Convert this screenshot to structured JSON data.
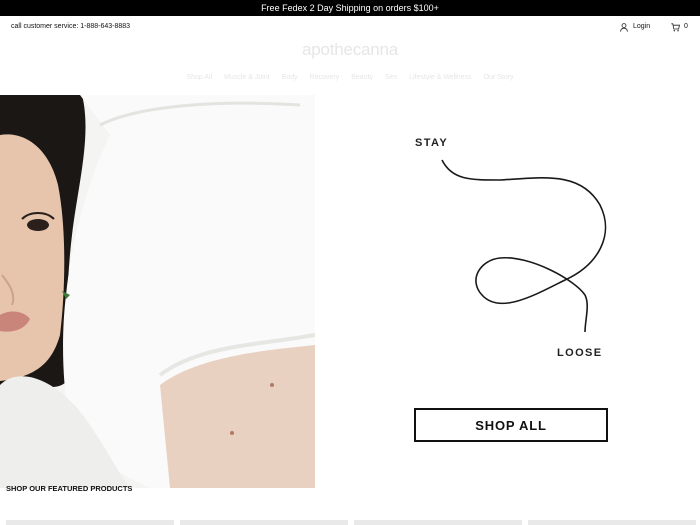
{
  "promo": {
    "text": "Free Fedex 2 Day Shipping on orders $100+"
  },
  "header": {
    "customer_service": "call customer service: 1-888-643-8883",
    "login_label": "Login",
    "cart_count": "0",
    "logo_text": "apothecanna"
  },
  "nav": {
    "items": [
      {
        "label": "Shop All"
      },
      {
        "label": "Muscle & Joint"
      },
      {
        "label": "Body"
      },
      {
        "label": "Recovery"
      },
      {
        "label": "Beauty"
      },
      {
        "label": "Sex"
      },
      {
        "label": "Lifestyle & Wellness"
      },
      {
        "label": "Our Story"
      }
    ]
  },
  "hero": {
    "word_top": "STAY",
    "word_bottom": "LOOSE",
    "cta_label": "SHOP ALL"
  },
  "featured": {
    "title": "SHOP OUR FEATURED PRODUCTS"
  },
  "icons": {
    "login": "user-icon",
    "cart": "cart-icon"
  }
}
